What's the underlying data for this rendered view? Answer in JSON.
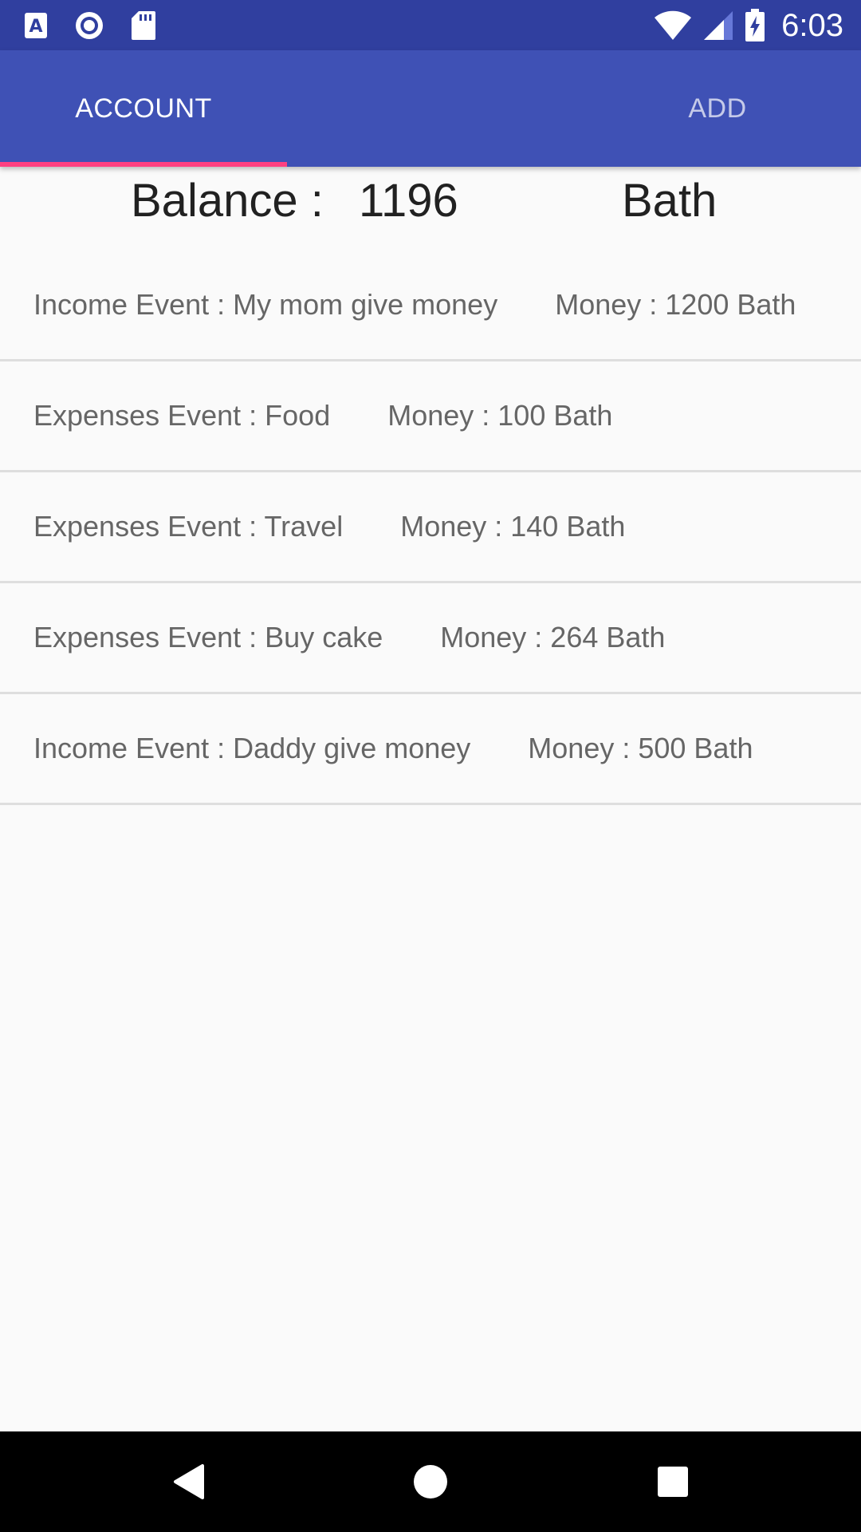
{
  "status_bar": {
    "time": "6:03",
    "icons": [
      "a-notification-icon",
      "circle-record-icon",
      "sd-card-icon",
      "wifi-icon",
      "cell-signal-icon",
      "battery-charging-icon"
    ]
  },
  "tabs": [
    {
      "label": "ACCOUNT",
      "selected": true
    },
    {
      "label": "ADD",
      "selected": false
    }
  ],
  "balance": {
    "label": "Balance :",
    "value": "1196",
    "unit": "Bath"
  },
  "events": [
    {
      "event": "Income Event : My mom give money",
      "money": "Money : 1200 Bath"
    },
    {
      "event": "Expenses Event : Food",
      "money": "Money : 100 Bath"
    },
    {
      "event": "Expenses Event : Travel",
      "money": "Money : 140 Bath"
    },
    {
      "event": "Expenses Event : Buy cake",
      "money": "Money : 264 Bath"
    },
    {
      "event": "Income Event : Daddy give money",
      "money": "Money : 500 Bath"
    }
  ],
  "nav_bar": {
    "icons": [
      "back-icon",
      "home-icon",
      "recents-icon"
    ]
  },
  "colors": {
    "status_bar": "#303f9f",
    "app_bar": "#3f51b5",
    "tab_indicator": "#ff4081",
    "background": "#fafafa"
  }
}
